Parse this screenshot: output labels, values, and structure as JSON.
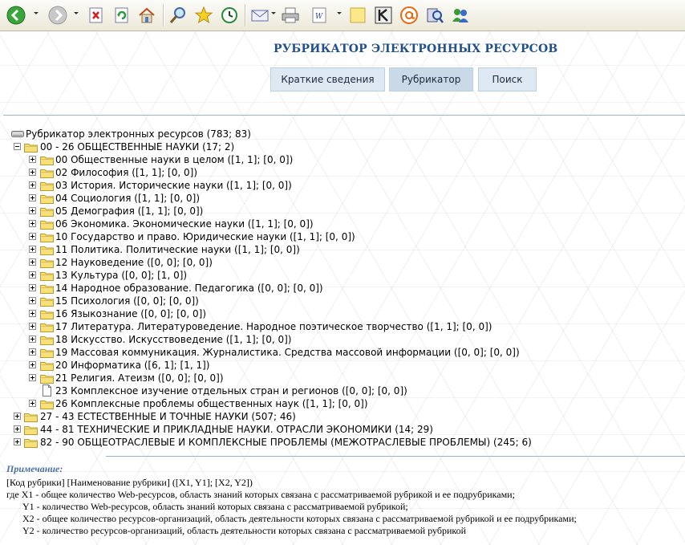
{
  "toolbar": {
    "icons": [
      "back-icon",
      "forward-icon",
      "stop-icon",
      "refresh-icon",
      "home-icon",
      "search-icon",
      "favorites-icon",
      "history-icon",
      "mail-icon",
      "print-icon",
      "edit-icon",
      "note-icon",
      "research-icon",
      "messenger-icon",
      "discuss-icon",
      "messenger-people-icon"
    ]
  },
  "page": {
    "title": "РУБРИКАТОР ЭЛЕКТРОННЫХ РЕСУРСОВ",
    "nav": [
      "Краткие сведения",
      "Рубрикатор",
      "Поиск"
    ]
  },
  "tree": {
    "root": "Рубрикатор электронных ресурсов (783; 83)",
    "items": [
      {
        "label": "00 - 26 ОБЩЕСТВЕННЫЕ НАУКИ (17; 2)",
        "level": 1,
        "expanded": true
      },
      {
        "label": "00 Общественные науки в целом ([1, 1]; [0, 0])",
        "level": 2
      },
      {
        "label": "02 Философия ([1, 1]; [0, 0])",
        "level": 2
      },
      {
        "label": "03 История. Исторические науки ([1, 1]; [0, 0])",
        "level": 2
      },
      {
        "label": "04 Социология ([1, 1]; [0, 0])",
        "level": 2
      },
      {
        "label": "05 Демография ([1, 1]; [0, 0])",
        "level": 2
      },
      {
        "label": "06 Экономика. Экономические науки ([1, 1]; [0, 0])",
        "level": 2
      },
      {
        "label": "10 Государство и право. Юридические науки ([1, 1]; [0, 0])",
        "level": 2
      },
      {
        "label": "11 Политика. Политические науки ([1, 1]; [0, 0])",
        "level": 2
      },
      {
        "label": "12 Науковедение ([0, 0]; [0, 0])",
        "level": 2
      },
      {
        "label": "13 Культура ([0, 0]; [1, 0])",
        "level": 2
      },
      {
        "label": "14 Народное образование. Педагогика ([0, 0]; [0, 0])",
        "level": 2
      },
      {
        "label": "15 Психология ([0, 0]; [0, 0])",
        "level": 2
      },
      {
        "label": "16 Языкознание ([0, 0]; [0, 0])",
        "level": 2
      },
      {
        "label": "17 Литература. Литературоведение. Народное поэтическое творчество ([1, 1]; [0, 0])",
        "level": 2
      },
      {
        "label": "18 Искусство. Искусствоведение ([1, 1]; [0, 0])",
        "level": 2
      },
      {
        "label": "19 Массовая коммуникация. Журналистика. Средства массовой информации ([0, 0]; [0, 0])",
        "level": 2
      },
      {
        "label": "20 Информатика ([6, 1]; [1, 1])",
        "level": 2
      },
      {
        "label": "21 Религия. Атеизм ([0, 0]; [0, 0])",
        "level": 2
      },
      {
        "label": "23 Комплексное изучение отдельных стран и регионов ([0, 0]; [0, 0])",
        "level": 2,
        "leaf": true
      },
      {
        "label": "26 Комплексные проблемы общественных наук ([1, 1]; [0, 0])",
        "level": 2
      },
      {
        "label": "27 - 43 ЕСТЕСТВЕННЫЕ И ТОЧНЫЕ НАУКИ (507; 46)",
        "level": 1
      },
      {
        "label": "44 - 81 ТЕХНИЧЕСКИЕ И ПРИКЛАДНЫЕ НАУКИ. ОТРАСЛИ ЭКОНОМИКИ (14; 29)",
        "level": 1
      },
      {
        "label": "82 - 90 ОБЩЕОТРАСЛЕВЫЕ И КОМПЛЕКСНЫЕ ПРОБЛЕМЫ (МЕЖОТРАСЛЕВЫЕ ПРОБЛЕМЫ) (245; 6)",
        "level": 1
      }
    ]
  },
  "note": {
    "title": "Примечание:",
    "lines": [
      "[Код рубрики] [Наименование рубрики] ([X1, Y1]; [X2, Y2])",
      "где X1 - общее количество Web-ресурсов, область знаний которых связана с рассматриваемой рубрикой и ее подрубриками;",
      "Y1 - количество Web-ресурсов, область знаний которых связана с рассматриваемой рубрикой;",
      "X2 - общее количество ресурсов-организаций, область деятельности которых связана с рассматриваемой рубрикой и ее подрубриками;",
      "Y2 - количество ресурсов-организаций, область деятельности которых связана с рассматриваемой рубрикой"
    ]
  }
}
